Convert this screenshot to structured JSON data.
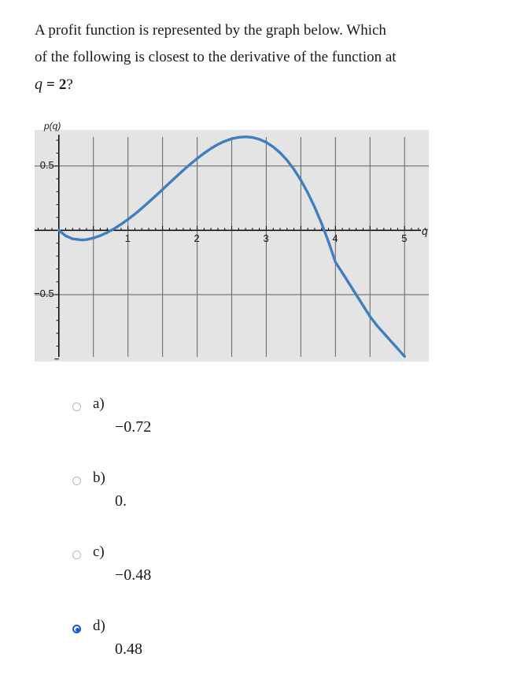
{
  "question": {
    "lines": [
      "A profit function is represented by the graph below. Which",
      "of the following is closest to the derivative of the function at"
    ],
    "last_line_var": "q",
    "last_line_eq": "=",
    "last_line_value": "2",
    "last_line_punct": "?"
  },
  "chart_data": {
    "type": "line",
    "title": "",
    "xlabel": "q",
    "ylabel": "p(q)",
    "xlim": [
      -0.35,
      5.35
    ],
    "ylim": [
      -1.02,
      0.78
    ],
    "grid": true,
    "legend": false,
    "background_color": "#e4e4e4",
    "grid_color": "#6e6e6e",
    "axis_color": "#000000",
    "series_color": "#3f7fbf",
    "x_ticks_labeled": [
      {
        "value": 1,
        "label": "1"
      },
      {
        "value": 2,
        "label": "2"
      },
      {
        "value": 3,
        "label": "3"
      },
      {
        "value": 4,
        "label": "4"
      },
      {
        "value": 5,
        "label": "5"
      }
    ],
    "y_ticks_labeled": [
      {
        "value": 0.5,
        "label": "0.5"
      },
      {
        "value": -0.5,
        "label": "−0.5"
      }
    ],
    "x_gridlines": [
      0.5,
      1,
      1.5,
      2,
      2.5,
      3,
      3.5,
      4,
      4.5,
      5
    ],
    "y_gridlines": [
      0.5,
      -0.5
    ],
    "x_minor_ticks_step": 0.1,
    "y_minor_ticks_step": 0.1,
    "series": [
      {
        "name": "p(q)",
        "x": [
          0.0,
          0.1,
          0.2,
          0.3,
          0.36,
          0.4,
          0.5,
          0.6,
          0.7,
          0.8,
          0.9,
          1.0,
          1.1,
          1.2,
          1.3,
          1.4,
          1.5,
          1.6,
          1.7,
          1.8,
          1.9,
          2.0,
          2.1,
          2.2,
          2.3,
          2.4,
          2.5,
          2.6,
          2.7,
          2.8,
          2.9,
          3.0,
          3.1,
          3.2,
          3.3,
          3.4,
          3.5,
          3.6,
          3.7,
          3.8,
          3.9,
          4.0,
          4.1,
          4.2,
          4.3,
          4.4,
          4.5,
          4.6,
          4.7,
          4.8,
          4.9,
          5.0
        ],
        "y": [
          0.0,
          -0.043,
          -0.066,
          -0.073,
          -0.074,
          -0.072,
          -0.06,
          -0.041,
          -0.017,
          0.013,
          0.047,
          0.085,
          0.127,
          0.172,
          0.219,
          0.268,
          0.318,
          0.368,
          0.418,
          0.467,
          0.514,
          0.558,
          0.599,
          0.636,
          0.668,
          0.693,
          0.712,
          0.723,
          0.727,
          0.722,
          0.708,
          0.684,
          0.649,
          0.603,
          0.545,
          0.474,
          0.39,
          0.292,
          0.18,
          0.053,
          -0.089,
          -0.247,
          -0.33,
          -0.415,
          -0.5,
          -0.585,
          -0.67,
          -0.74,
          -0.8,
          -0.86,
          -0.92,
          -0.98
        ]
      }
    ],
    "annotations": []
  },
  "options": [
    {
      "letter": "a)",
      "value": "−0.72",
      "selected": false
    },
    {
      "letter": "b)",
      "value": "0.",
      "selected": false
    },
    {
      "letter": "c)",
      "value": "−0.48",
      "selected": false
    },
    {
      "letter": "d)",
      "value": "0.48",
      "selected": true
    }
  ]
}
